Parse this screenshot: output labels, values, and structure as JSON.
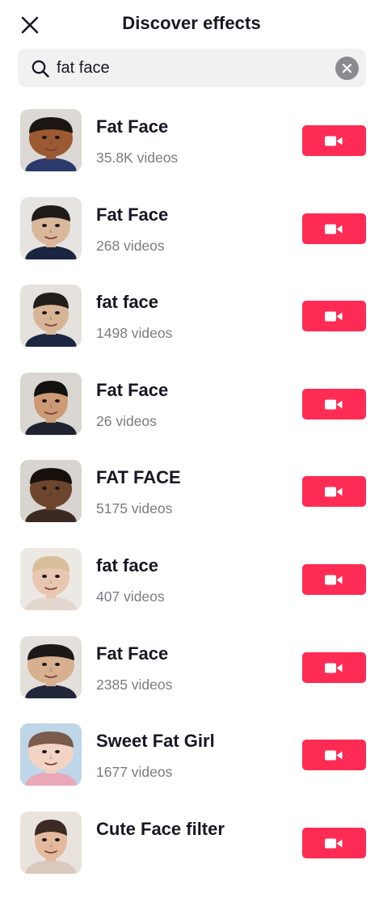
{
  "header": {
    "title": "Discover effects",
    "close_icon": "close-icon"
  },
  "search": {
    "value": "fat face",
    "search_icon": "search-icon",
    "clear_icon": "clear-icon"
  },
  "colors": {
    "accent": "#fe2c55",
    "text": "#161823",
    "muted": "#7b7c80",
    "search_bg": "#f1f1f2"
  },
  "effects": [
    {
      "name": "Fat Face",
      "count": "35.8K videos",
      "thumb": {
        "skin": "#9c5a33",
        "hair": "#1c1612",
        "bg": "#dcd8d4",
        "shirt": "#2b3a6b",
        "cheek": 1.35
      }
    },
    {
      "name": "Fat Face",
      "count": "268 videos",
      "thumb": {
        "skin": "#d9b79a",
        "hair": "#1e1b19",
        "bg": "#e6e4e0",
        "shirt": "#1b2540",
        "cheek": 1.2
      }
    },
    {
      "name": "fat face",
      "count": "1498 videos",
      "thumb": {
        "skin": "#d8b497",
        "hair": "#221e1a",
        "bg": "#e5e2de",
        "shirt": "#1d2742",
        "cheek": 1.1
      }
    },
    {
      "name": "Fat Face",
      "count": "26 videos",
      "thumb": {
        "skin": "#cc9a75",
        "hair": "#141210",
        "bg": "#dad7d2",
        "shirt": "#1f2330",
        "cheek": 1.05
      }
    },
    {
      "name": "FAT FACE",
      "count": "5175 videos",
      "thumb": {
        "skin": "#6e452d",
        "hair": "#17110d",
        "bg": "#d8d4d0",
        "shirt": "#3a2a22",
        "cheek": 1.3
      }
    },
    {
      "name": "fat face",
      "count": "407 videos",
      "thumb": {
        "skin": "#e8c7b2",
        "hair": "#d8bf9a",
        "bg": "#ece8e4",
        "shirt": "#e3d8cf",
        "cheek": 1.15
      }
    },
    {
      "name": "Fat Face",
      "count": "2385 videos",
      "thumb": {
        "skin": "#d6b08f",
        "hair": "#1b1816",
        "bg": "#e3e0dc",
        "shirt": "#23263a",
        "cheek": 1.45
      }
    },
    {
      "name": "Sweet Fat Girl",
      "count": "1677 videos",
      "thumb": {
        "skin": "#f3d3c4",
        "hair": "#7a5a4a",
        "bg": "#bfd6e8",
        "shirt": "#e9a8b8",
        "cheek": 1.4
      }
    },
    {
      "name": "Cute Face filter",
      "count": "",
      "thumb": {
        "skin": "#e3b99e",
        "hair": "#3a2a22",
        "bg": "#e9e3de",
        "shirt": "#d9c9bf",
        "cheek": 1.0
      }
    }
  ],
  "record_button_icon": "video-camera-icon"
}
